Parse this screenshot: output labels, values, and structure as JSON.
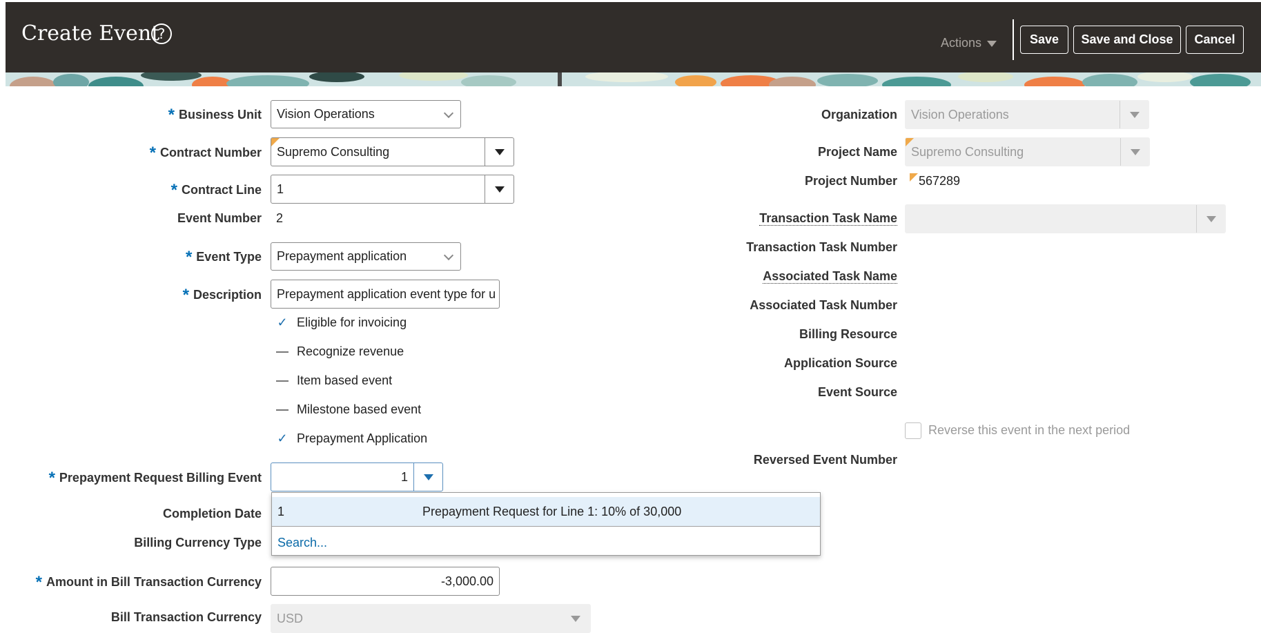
{
  "header": {
    "title": "Create Event",
    "help_icon": "help-circle-icon",
    "actions_label": "Actions",
    "save_label": "Save",
    "save_close_label": "Save and Close",
    "cancel_label": "Cancel"
  },
  "left": {
    "business_unit": {
      "label": "Business Unit",
      "value": "Vision Operations"
    },
    "contract_number": {
      "label": "Contract Number",
      "value": "Supremo Consulting"
    },
    "contract_line": {
      "label": "Contract Line",
      "value": "1"
    },
    "event_number": {
      "label": "Event Number",
      "value": "2"
    },
    "event_type": {
      "label": "Event Type",
      "value": "Prepayment application"
    },
    "description": {
      "label": "Description",
      "value": "Prepayment application event type for u"
    },
    "checks": {
      "eligible_invoicing": {
        "label": "Eligible for invoicing",
        "checked": true
      },
      "recognize_revenue": {
        "label": "Recognize revenue",
        "checked": false
      },
      "item_based": {
        "label": "Item based event",
        "checked": false
      },
      "milestone_based": {
        "label": "Milestone based event",
        "checked": false
      },
      "prepayment_application": {
        "label": "Prepayment Application",
        "checked": true
      }
    },
    "prepayment_request": {
      "label": "Prepayment Request Billing Event",
      "value": "1"
    },
    "completion_date": {
      "label": "Completion Date"
    },
    "billing_currency_type": {
      "label": "Billing Currency Type"
    },
    "amount": {
      "label": "Amount in Bill Transaction Currency",
      "value": "-3,000.00"
    },
    "bill_currency": {
      "label": "Bill Transaction Currency",
      "value": "USD"
    }
  },
  "popup": {
    "rows": [
      {
        "number": "1",
        "description": "Prepayment Request for Line 1: 10% of 30,000"
      }
    ],
    "search_label": "Search..."
  },
  "right": {
    "organization": {
      "label": "Organization",
      "value": "Vision Operations"
    },
    "project_name": {
      "label": "Project Name",
      "value": "Supremo Consulting"
    },
    "project_number": {
      "label": "Project Number",
      "value": "567289"
    },
    "transaction_task_name": {
      "label": "Transaction Task Name",
      "value": ""
    },
    "transaction_task_number": {
      "label": "Transaction Task Number"
    },
    "associated_task_name": {
      "label": "Associated Task Name"
    },
    "associated_task_number": {
      "label": "Associated Task Number"
    },
    "billing_resource": {
      "label": "Billing Resource"
    },
    "application_source": {
      "label": "Application Source"
    },
    "event_source": {
      "label": "Event Source"
    },
    "reverse_event": {
      "label": "Reverse this event in the next period",
      "checked": false
    },
    "reversed_event_number": {
      "label": "Reversed Event Number"
    }
  },
  "colors": {
    "header_bg": "#312d2a",
    "required": "#0570b6",
    "link": "#0a6aa8",
    "selected_row": "#e4f0fa"
  }
}
